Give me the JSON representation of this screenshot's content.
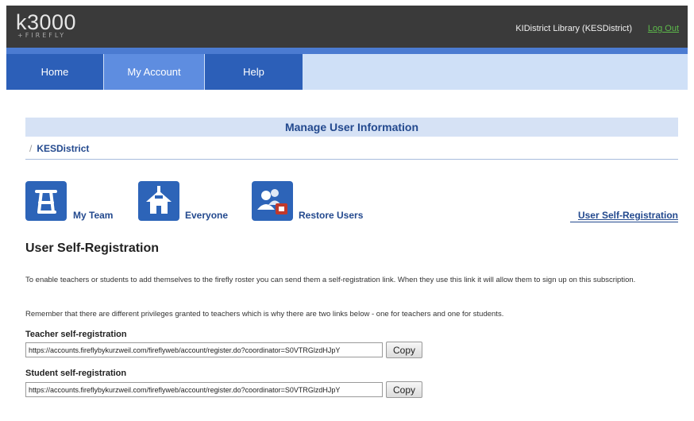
{
  "header": {
    "logo_main": "k3000",
    "logo_sub": "+FIREFLY",
    "org_name": "KIDistrict Library (KESDistrict)",
    "logout_label": "Log Out"
  },
  "nav": {
    "tabs": [
      {
        "label": "Home"
      },
      {
        "label": "My Account",
        "active": true
      },
      {
        "label": "Help"
      }
    ]
  },
  "manage": {
    "title": "Manage User Information",
    "breadcrumb_sep": "/",
    "breadcrumb": "KESDistrict"
  },
  "tiles": [
    {
      "label": "My Team",
      "icon": "team-icon"
    },
    {
      "label": "Everyone",
      "icon": "school-icon"
    },
    {
      "label": "Restore Users",
      "icon": "restore-users-icon"
    }
  ],
  "self_reg_link": "User Self-Registration",
  "main": {
    "title": "User Self-Registration",
    "para1": "To enable teachers or students to add themselves to the firefly roster you can send them a self-registration link. When they use this link it will allow them to sign up on this subscription.",
    "para2": "Remember that there are different privileges granted to teachers which is why there are two links below - one for teachers and one for students.",
    "teacher_label": "Teacher self-registration",
    "teacher_url": "https://accounts.fireflybykurzweil.com/fireflyweb/account/register.do?coordinator=S0VTRGlzdHJpY",
    "student_label": "Student self-registration",
    "student_url": "https://accounts.fireflybykurzweil.com/fireflyweb/account/register.do?coordinator=S0VTRGlzdHJpY",
    "copy_label": "Copy"
  },
  "colors": {
    "header_bg": "#3a3a3a",
    "nav_dark": "#2c5fb8",
    "nav_active": "#5e8de0",
    "accent_text": "#23498e",
    "logout_green": "#5dba4b"
  }
}
